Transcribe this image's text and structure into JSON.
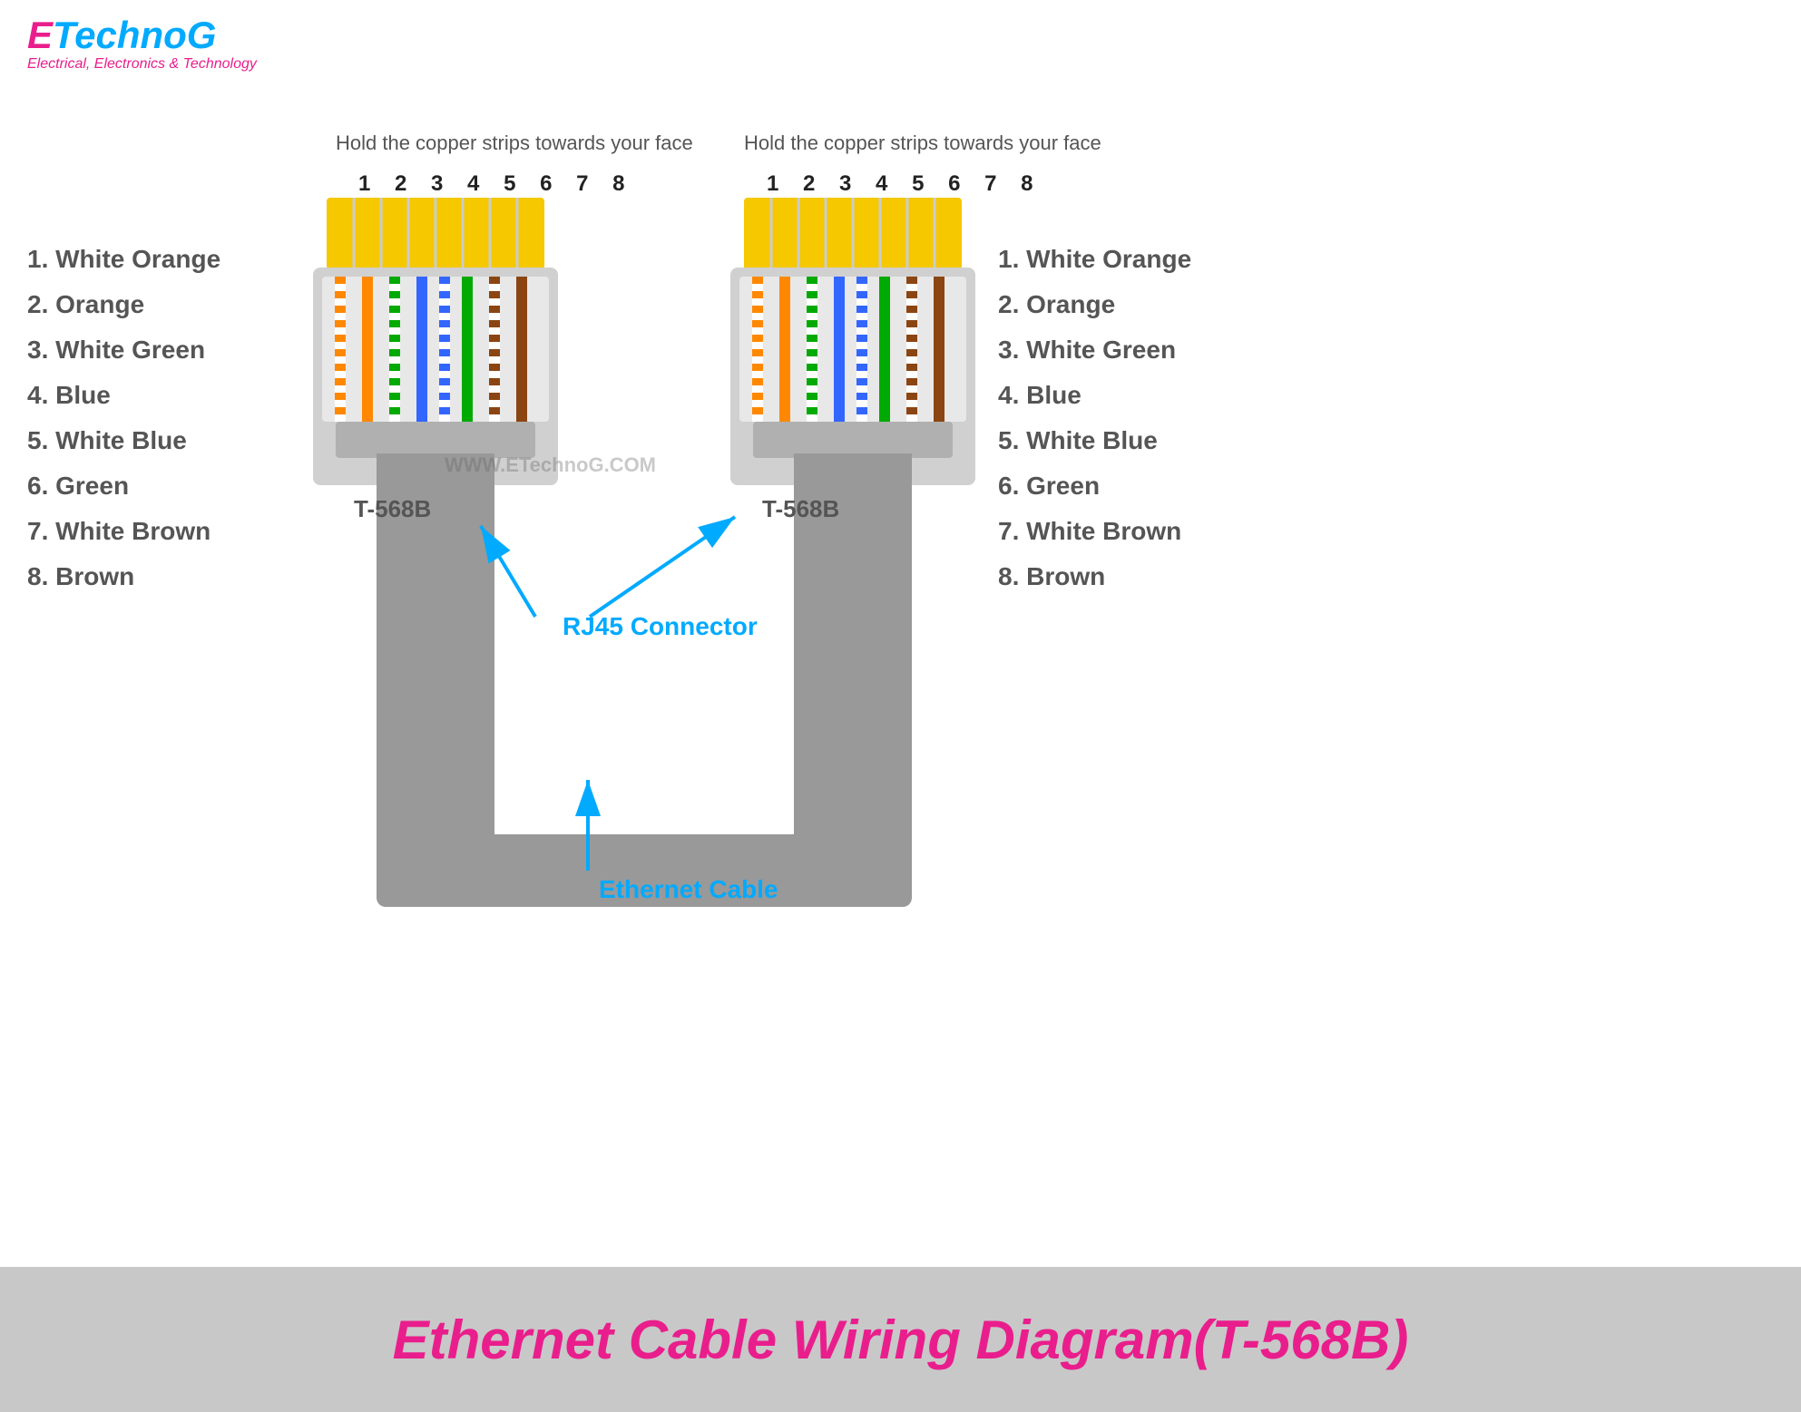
{
  "logo": {
    "e": "E",
    "technog": "TechnoG",
    "subtitle": "Electrical, Electronics & Technology"
  },
  "left_connector": {
    "instruction": "Hold the copper strips towards your face",
    "pin_numbers": "1 2 3 4 5 6 7 8",
    "standard": "T-568B"
  },
  "right_connector": {
    "instruction": "Hold the copper strips towards your face",
    "pin_numbers": "1 2 3 4 5 6 7 8",
    "standard": "T-568B"
  },
  "wire_list": [
    {
      "num": "1.",
      "label": "White Orange"
    },
    {
      "num": "2.",
      "label": "Orange"
    },
    {
      "num": "3.",
      "label": "White Green"
    },
    {
      "num": "4.",
      "label": "Blue"
    },
    {
      "num": "5.",
      "label": "White Blue"
    },
    {
      "num": "6.",
      "label": "Green"
    },
    {
      "num": "7.",
      "label": "White Brown"
    },
    {
      "num": "8.",
      "label": "Brown"
    }
  ],
  "labels": {
    "rj45_connector": "RJ45 Connector",
    "ethernet_cable": "Ethernet Cable",
    "watermark": "WWW.ETechnoG.COM"
  },
  "footer": {
    "title": "Ethernet Cable Wiring Diagram(T-568B)"
  }
}
